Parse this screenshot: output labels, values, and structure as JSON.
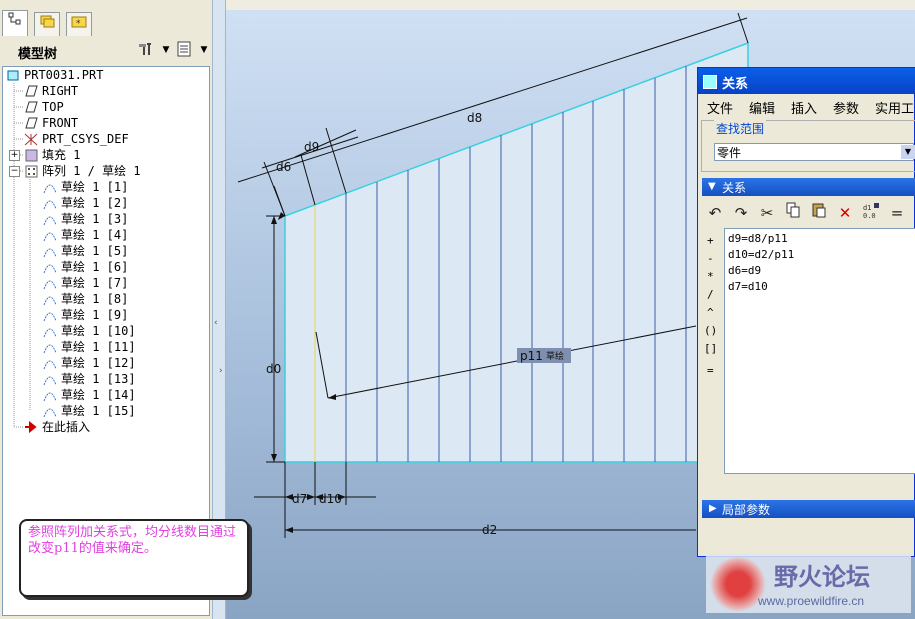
{
  "model_tree": {
    "title": "模型树",
    "items": [
      {
        "label": "PRT0031.PRT"
      },
      {
        "label": "RIGHT"
      },
      {
        "label": "TOP"
      },
      {
        "label": "FRONT"
      },
      {
        "label": "PRT_CSYS_DEF"
      },
      {
        "label": "填充 1"
      },
      {
        "label": "阵列 1 / 草绘 1"
      },
      {
        "label": "草绘 1 [1]"
      },
      {
        "label": "草绘 1 [2]"
      },
      {
        "label": "草绘 1 [3]"
      },
      {
        "label": "草绘 1 [4]"
      },
      {
        "label": "草绘 1 [5]"
      },
      {
        "label": "草绘 1 [6]"
      },
      {
        "label": "草绘 1 [7]"
      },
      {
        "label": "草绘 1 [8]"
      },
      {
        "label": "草绘 1 [9]"
      },
      {
        "label": "草绘 1 [10]"
      },
      {
        "label": "草绘 1 [11]"
      },
      {
        "label": "草绘 1 [12]"
      },
      {
        "label": "草绘 1 [13]"
      },
      {
        "label": "草绘 1 [14]"
      },
      {
        "label": "草绘 1 [15]"
      },
      {
        "label": "在此插入"
      }
    ]
  },
  "drawing": {
    "dims": {
      "d8": "d8",
      "d9": "d9",
      "d6": "d6",
      "d0": "d0",
      "d7": "d7",
      "d10": "d10",
      "d2": "d2",
      "p11": "p11",
      "p11_tag": "草绘"
    }
  },
  "note": {
    "text": "参照阵列加关系式，均分线数目通过改变p11的值来确定。"
  },
  "dialog": {
    "title": "关系",
    "menu": [
      "文件",
      "编辑",
      "插入",
      "参数",
      "实用工"
    ],
    "scope_label": "查找范围",
    "scope_value": "零件",
    "relations_header": "关系",
    "operators": [
      "+",
      "-",
      "*",
      "/",
      "^",
      "()",
      "[]",
      "="
    ],
    "relations": [
      "d9=d8/p11",
      "d10=d2/p11",
      "d6=d9",
      "d7=d10"
    ],
    "local_params_header": "局部参数"
  },
  "watermark": {
    "name": "野火论坛",
    "url": "www.proewildfire.cn"
  }
}
